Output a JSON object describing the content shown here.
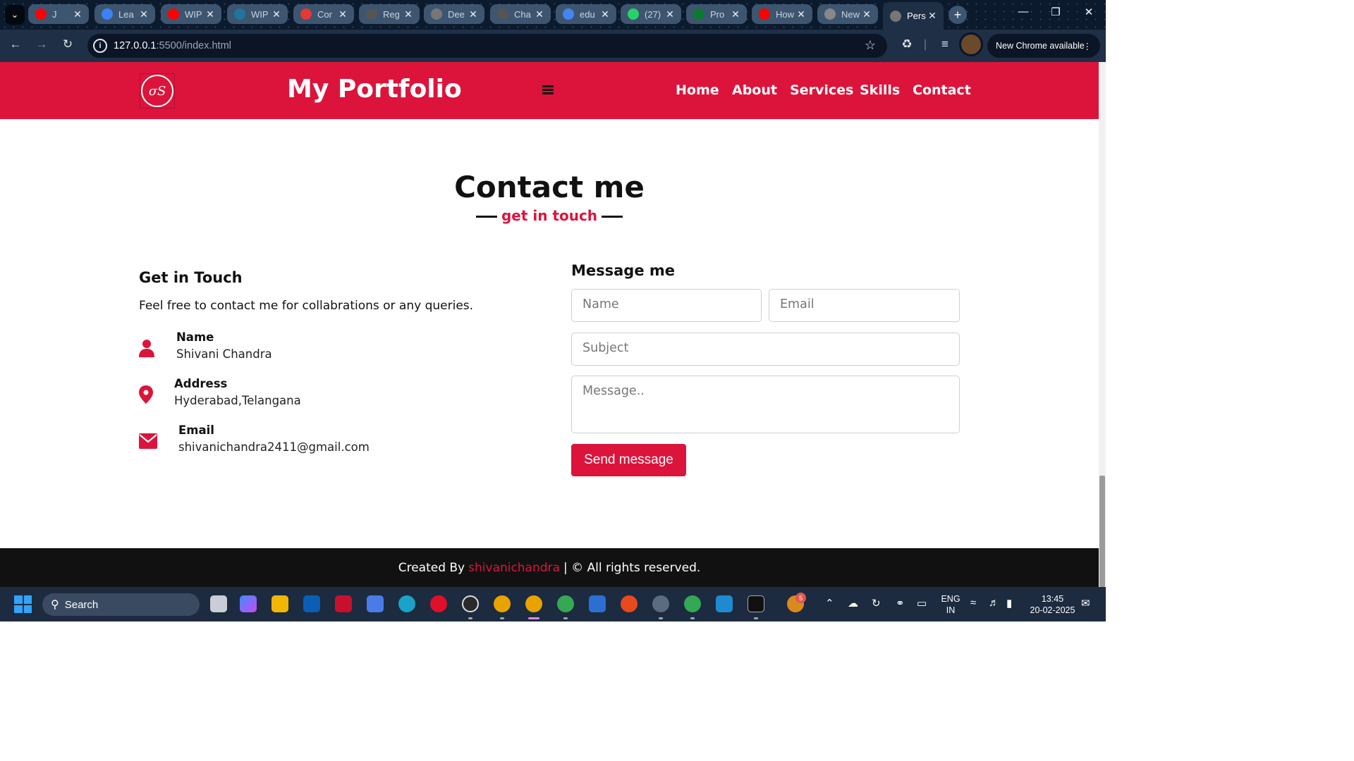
{
  "browser": {
    "tabs": [
      {
        "title": "J",
        "favicon": "youtube-icon",
        "color": "#ff0000"
      },
      {
        "title": "Lea",
        "favicon": "learn-icon",
        "color": "#3b82f6"
      },
      {
        "title": "WIP",
        "favicon": "youtube-icon",
        "color": "#ff0000"
      },
      {
        "title": "WIP",
        "favicon": "wordpress-icon",
        "color": "#21759b"
      },
      {
        "title": "Cor",
        "favicon": "multicolor-icon",
        "color": "#e53935"
      },
      {
        "title": "Reg",
        "favicon": "openai-icon",
        "color": "#555555"
      },
      {
        "title": "Dee",
        "favicon": "globe-icon",
        "color": "#777777"
      },
      {
        "title": "Cha",
        "favicon": "openai-icon",
        "color": "#555555"
      },
      {
        "title": "edu",
        "favicon": "google-icon",
        "color": "#4285f4"
      },
      {
        "title": "(27)",
        "favicon": "whatsapp-icon",
        "color": "#25d366"
      },
      {
        "title": "Pro",
        "favicon": "leaf-icon",
        "color": "#0a7a2f"
      },
      {
        "title": "How",
        "favicon": "youtube-icon",
        "color": "#ff0000"
      },
      {
        "title": "New",
        "favicon": "chrome-icon",
        "color": "#888888"
      },
      {
        "title": "Pers",
        "favicon": "globe-icon",
        "color": "#777777",
        "active": true
      }
    ],
    "url_host": "127.0.0.1",
    "url_rest": ":5500/index.html",
    "update_label": "New Chrome available"
  },
  "site": {
    "brand": "My Portfolio",
    "logo_text": "σS",
    "nav": [
      "Home",
      "About",
      "Services",
      "Skills",
      "Contact"
    ],
    "accent": "#dc143c"
  },
  "contact": {
    "title": "Contact me",
    "subtitle": "get in touch",
    "left_heading": "Get in Touch",
    "intro": "Feel free to contact me for collabrations or any queries.",
    "items": [
      {
        "label": "Name",
        "value": "Shivani Chandra",
        "icon": "user-icon"
      },
      {
        "label": "Address",
        "value": "Hyderabad,Telangana",
        "icon": "map-marker-icon"
      },
      {
        "label": "Email",
        "value": "shivanichandra2411@gmail.com",
        "icon": "envelope-icon"
      }
    ],
    "form_heading": "Message me",
    "placeholders": {
      "name": "Name",
      "email": "Email",
      "subject": "Subject",
      "message": "Message.."
    },
    "send_label": "Send message"
  },
  "footer": {
    "prefix": "Created By",
    "author": "shivanichandra",
    "suffix": "| © All rights reserved."
  },
  "taskbar": {
    "search_label": "Search",
    "lang_line1": "ENG",
    "lang_line2": "IN",
    "time": "13:45",
    "date": "20-02-2025",
    "notification_count": "5"
  }
}
